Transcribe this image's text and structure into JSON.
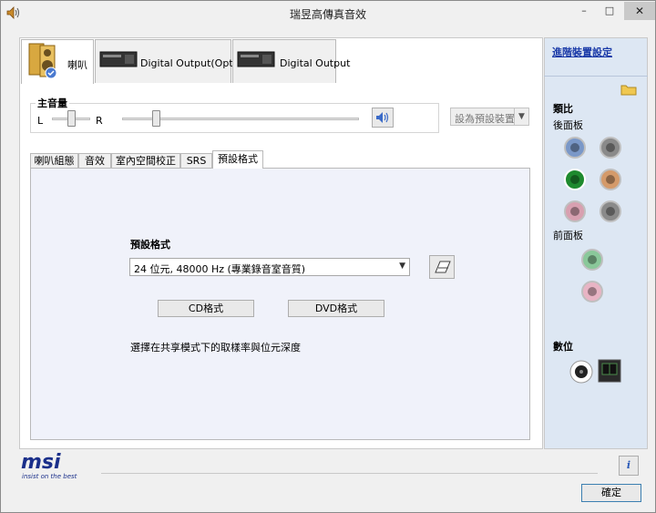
{
  "window": {
    "title": "瑞昱高傳真音效",
    "minimize": "–",
    "maximize": "□",
    "close": "✕"
  },
  "device_tabs": [
    {
      "label": "喇叭",
      "active": true
    },
    {
      "label": "Digital Output(Optical)",
      "active": false
    },
    {
      "label": "Digital Output",
      "active": false
    }
  ],
  "main_volume": {
    "title": "主音量",
    "left_label": "L",
    "right_label": "R",
    "balance": 0.5,
    "level": 0.13
  },
  "set_default": {
    "label": "設為預設裝置",
    "arrow": "▼"
  },
  "inner_tabs": [
    "喇叭組態",
    "音效",
    "室內空間校正",
    "SRS",
    "預設格式"
  ],
  "default_format": {
    "heading": "預設格式",
    "selected": "24 位元, 48000 Hz (專業錄音室音質)",
    "cd_button": "CD格式",
    "dvd_button": "DVD格式",
    "description": "選擇在共享模式下的取樣率與位元深度"
  },
  "right_panel": {
    "advanced_link": "進階裝置設定",
    "jacks_title": "類比",
    "rear_panel": "後面板",
    "front_panel": "前面板",
    "digital_title": "數位"
  },
  "colors": {
    "jack_blue": "#7a98c8",
    "jack_green": "#1e8a2e",
    "jack_orange": "#d49a6a",
    "jack_pink": "#d8a0b0",
    "jack_gray": "#8a8a8a",
    "jack_front_green": "#8ac89a",
    "jack_front_pink": "#e8b4c4",
    "msi_blue": "#1a2f8a"
  },
  "branding": {
    "logo": "msi",
    "tagline": "insist on the best"
  },
  "ok_button": "確定"
}
